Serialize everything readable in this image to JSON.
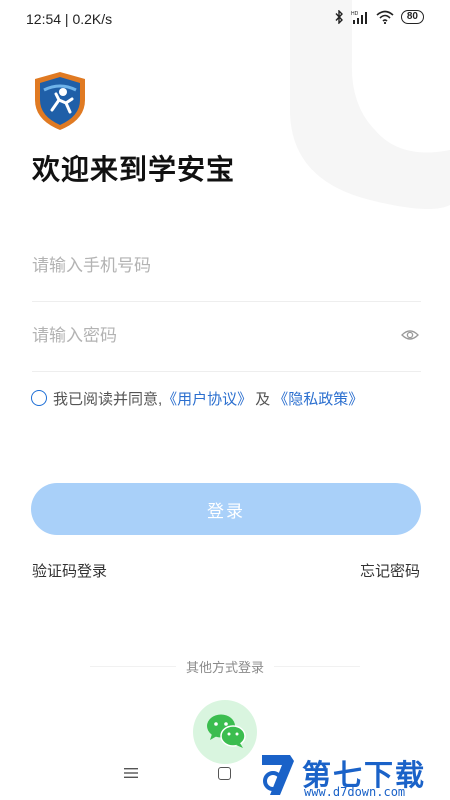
{
  "status_bar": {
    "time": "12:54 | 0.2K/s",
    "network_label": "HD",
    "battery": "80"
  },
  "header": {
    "welcome_title": "欢迎来到学安宝",
    "logo_icon": "shield-runner-logo-icon"
  },
  "form": {
    "phone_placeholder": "请输入手机号码",
    "password_placeholder": "请输入密码",
    "password_toggle_icon": "eye-icon"
  },
  "agreement": {
    "prefix": "我已阅读并同意,",
    "user_agreement": "《用户协议》",
    "and": "及",
    "privacy_policy": "《隐私政策》"
  },
  "actions": {
    "login_label": "登录",
    "sms_login": "验证码登录",
    "forgot_password": "忘记密码"
  },
  "other_login": {
    "label": "其他方式登录",
    "wechat_icon": "wechat-icon"
  },
  "watermark": {
    "title": "第七下载站",
    "url": "www.d7down.com"
  },
  "colors": {
    "accent": "#2b6fcf",
    "login_button_disabled": "#a9d0f9",
    "wechat_green": "#3bbd4f"
  }
}
